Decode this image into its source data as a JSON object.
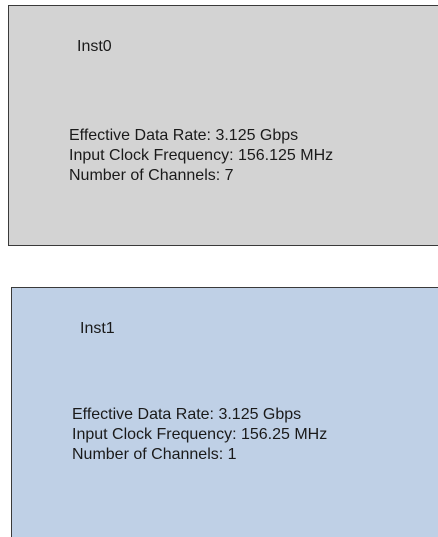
{
  "instances": [
    {
      "name": "Inst0",
      "fill": "#d3d3d3",
      "details": [
        "Effective Data Rate: 3.125 Gbps",
        "Input Clock Frequency: 156.125 MHz",
        "Number of Channels: 7"
      ]
    },
    {
      "name": "Inst1",
      "fill": "#bfd0e6",
      "details": [
        "Effective Data Rate: 3.125 Gbps",
        "Input Clock Frequency: 156.25 MHz",
        "Number of Channels: 1"
      ]
    }
  ]
}
